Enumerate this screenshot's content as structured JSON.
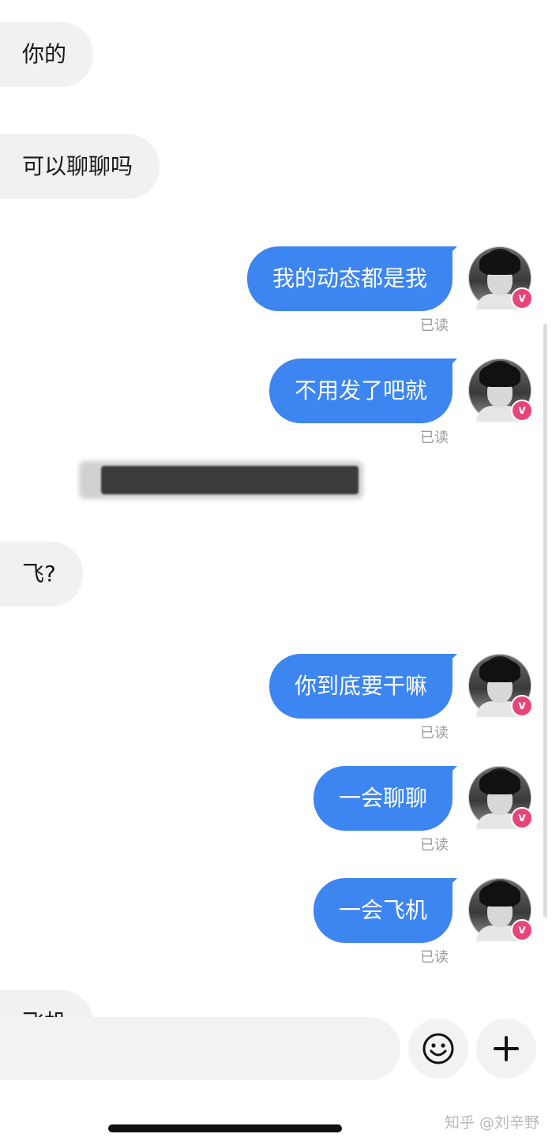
{
  "messages": [
    {
      "side": "in",
      "text": "你的"
    },
    {
      "side": "in",
      "text": "可以聊聊吗"
    },
    {
      "side": "out",
      "text": "我的动态都是我",
      "status": "已读"
    },
    {
      "side": "out",
      "text": "不用发了吧就",
      "status": "已读"
    },
    {
      "side": "in",
      "text": "[redacted]"
    },
    {
      "side": "in",
      "text": "飞?"
    },
    {
      "side": "out",
      "text": "你到底要干嘛",
      "status": "已读"
    },
    {
      "side": "out",
      "text": "一会聊聊",
      "status": "已读"
    },
    {
      "side": "out",
      "text": "一会飞机",
      "status": "已读"
    },
    {
      "side": "in",
      "text": "飞机"
    }
  ],
  "avatar": {
    "badge": "v",
    "badge_color": "#e7457a"
  },
  "colors": {
    "outgoing_bubble": "#3d85f0",
    "incoming_bubble": "#f1f1f1"
  },
  "composer": {
    "input_value": "",
    "emoji_icon": "smiley-icon",
    "plus_icon": "plus-icon"
  },
  "watermark": "知乎 @刘辛野"
}
